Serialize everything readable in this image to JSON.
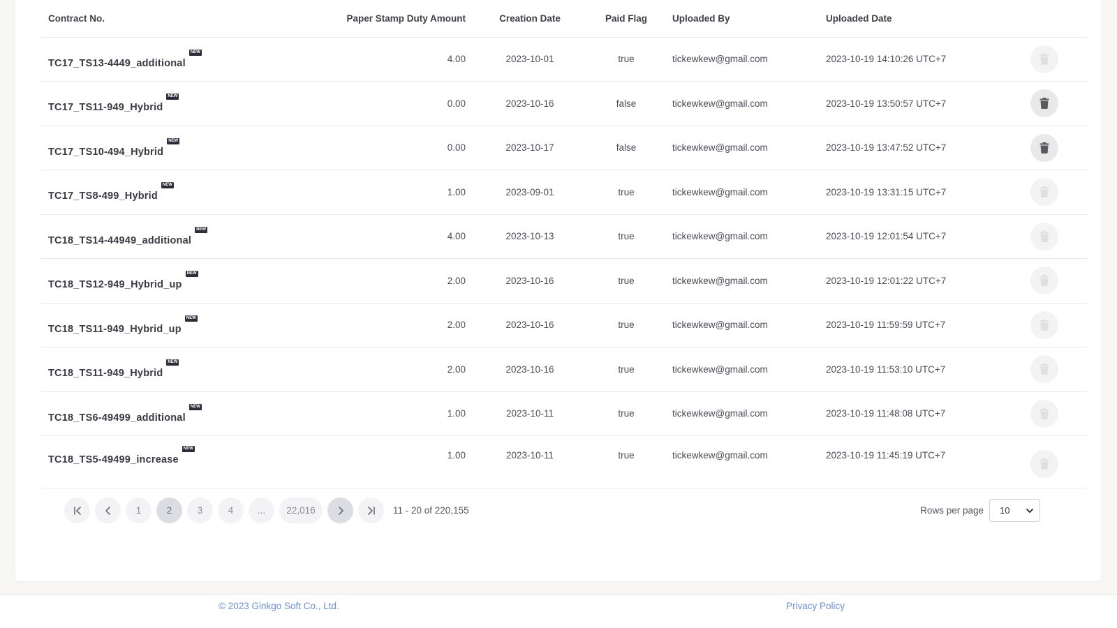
{
  "table": {
    "headers": {
      "contract_no": "Contract No.",
      "stamp_duty": "Paper Stamp Duty Amount",
      "creation_date": "Creation Date",
      "paid_flag": "Paid Flag",
      "uploaded_by": "Uploaded By",
      "uploaded_date": "Uploaded Date"
    },
    "new_badge": "NEW",
    "rows": [
      {
        "contract": "TC17_TS13-4449_additional",
        "amount": "4.00",
        "created": "2023-10-01",
        "paid": "true",
        "by": "tickewkew@gmail.com",
        "uploaded": "2023-10-19 14:10:26 UTC+7",
        "delete_enabled": false
      },
      {
        "contract": "TC17_TS11-949_Hybrid",
        "amount": "0.00",
        "created": "2023-10-16",
        "paid": "false",
        "by": "tickewkew@gmail.com",
        "uploaded": "2023-10-19 13:50:57 UTC+7",
        "delete_enabled": true
      },
      {
        "contract": "TC17_TS10-494_Hybrid",
        "amount": "0.00",
        "created": "2023-10-17",
        "paid": "false",
        "by": "tickewkew@gmail.com",
        "uploaded": "2023-10-19 13:47:52 UTC+7",
        "delete_enabled": true
      },
      {
        "contract": "TC17_TS8-499_Hybrid",
        "amount": "1.00",
        "created": "2023-09-01",
        "paid": "true",
        "by": "tickewkew@gmail.com",
        "uploaded": "2023-10-19 13:31:15 UTC+7",
        "delete_enabled": false
      },
      {
        "contract": "TC18_TS14-44949_additional",
        "amount": "4.00",
        "created": "2023-10-13",
        "paid": "true",
        "by": "tickewkew@gmail.com",
        "uploaded": "2023-10-19 12:01:54 UTC+7",
        "delete_enabled": false
      },
      {
        "contract": "TC18_TS12-949_Hybrid_up",
        "amount": "2.00",
        "created": "2023-10-16",
        "paid": "true",
        "by": "tickewkew@gmail.com",
        "uploaded": "2023-10-19 12:01:22 UTC+7",
        "delete_enabled": false
      },
      {
        "contract": "TC18_TS11-949_Hybrid_up",
        "amount": "2.00",
        "created": "2023-10-16",
        "paid": "true",
        "by": "tickewkew@gmail.com",
        "uploaded": "2023-10-19 11:59:59 UTC+7",
        "delete_enabled": false
      },
      {
        "contract": "TC18_TS11-949_Hybrid",
        "amount": "2.00",
        "created": "2023-10-16",
        "paid": "true",
        "by": "tickewkew@gmail.com",
        "uploaded": "2023-10-19 11:53:10 UTC+7",
        "delete_enabled": false
      },
      {
        "contract": "TC18_TS6-49499_additional",
        "amount": "1.00",
        "created": "2023-10-11",
        "paid": "true",
        "by": "tickewkew@gmail.com",
        "uploaded": "2023-10-19 11:48:08 UTC+7",
        "delete_enabled": false
      },
      {
        "contract": "TC18_TS5-49499_increase",
        "amount": "1.00",
        "created": "2023-10-11",
        "paid": "true",
        "by": "tickewkew@gmail.com",
        "uploaded": "2023-10-19 11:45:19 UTC+7",
        "delete_enabled": false
      }
    ]
  },
  "pagination": {
    "pages": [
      "1",
      "2",
      "3",
      "4",
      "...",
      "22,016"
    ],
    "current_page": "2",
    "range_text": "11 - 20 of 220,155",
    "rows_per_page_label": "Rows per page",
    "rows_per_page_value": "10",
    "icons": [
      "first-page-icon",
      "prev-page-icon",
      "next-page-icon",
      "last-page-icon",
      "chevron-down-icon"
    ]
  },
  "footer": {
    "copyright": "© 2023 Ginkgo Soft Co., Ltd.",
    "privacy": "Privacy Policy"
  },
  "colors": {
    "footer_link": "#6c8fd6",
    "page_background": "#f7f6f5",
    "delete_icon_enabled": "#5a5a60",
    "delete_icon_disabled": "#e0e0e0"
  }
}
